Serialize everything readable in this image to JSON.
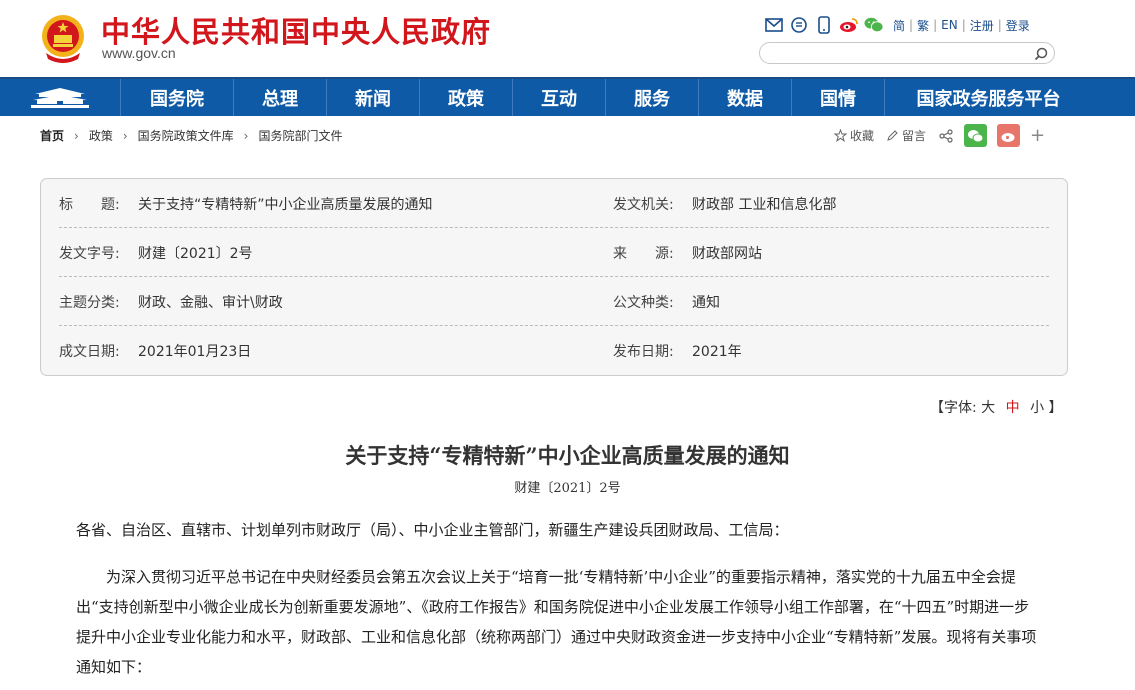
{
  "header": {
    "site_title": "中华人民共和国中央人民政府",
    "site_url": "www.gov.cn",
    "lang_simplified": "简",
    "lang_traditional": "繁",
    "lang_english": "EN",
    "register": "注册",
    "login": "登录",
    "search_placeholder": ""
  },
  "nav": {
    "items": [
      "国务院",
      "总理",
      "新闻",
      "政策",
      "互动",
      "服务",
      "数据",
      "国情",
      "国家政务服务平台"
    ]
  },
  "breadcrumb": {
    "items": [
      "首页",
      "政策",
      "国务院政策文件库",
      "国务院部门文件"
    ]
  },
  "share": {
    "favorite": "收藏",
    "comment": "留言",
    "plus": "+"
  },
  "info": {
    "title_label": "标　　题:",
    "title_value": "关于支持“专精特新”中小企业高质量发展的通知",
    "issuer_label": "发文机关:",
    "issuer_value": "财政部 工业和信息化部",
    "docno_label": "发文字号:",
    "docno_value": "财建〔2021〕2号",
    "source_label": "来　　源:",
    "source_value": "财政部网站",
    "topic_label": "主题分类:",
    "topic_value": "财政、金融、审计\\财政",
    "type_label": "公文种类:",
    "type_value": "通知",
    "written_label": "成文日期:",
    "written_value": "2021年01月23日",
    "published_label": "发布日期:",
    "published_value": "2021年"
  },
  "fontsize": {
    "prefix": "【字体:",
    "large": "大",
    "medium": "中",
    "small": "小",
    "suffix": "】"
  },
  "article": {
    "title": "关于支持“专精特新”中小企业高质量发展的通知",
    "docno": "财建〔2021〕2号",
    "greeting": "各省、自治区、直辖市、计划单列市财政厅（局）、中小企业主管部门，新疆生产建设兵团财政局、工信局：",
    "paragraph": "为深入贯彻习近平总书记在中央财经委员会第五次会议上关于“培育一批‘专精特新’中小企业”的重要指示精神，落实党的十九届五中全会提出“支持创新型中小微企业成长为创新重要发源地”、《政府工作报告》和国务院促进中小企业发展工作领导小组工作部署，在“十四五”时期进一步提升中小企业专业化能力和水平，财政部、工业和信息化部（统称两部门）通过中央财政资金进一步支持中小企业“专精特新”发展。现将有关事项通知如下："
  },
  "colors": {
    "brand_red": "#d1161c",
    "nav_blue": "#0e5aa7",
    "wechat_green": "#4bb54b",
    "weibo_red": "#e8756a"
  }
}
